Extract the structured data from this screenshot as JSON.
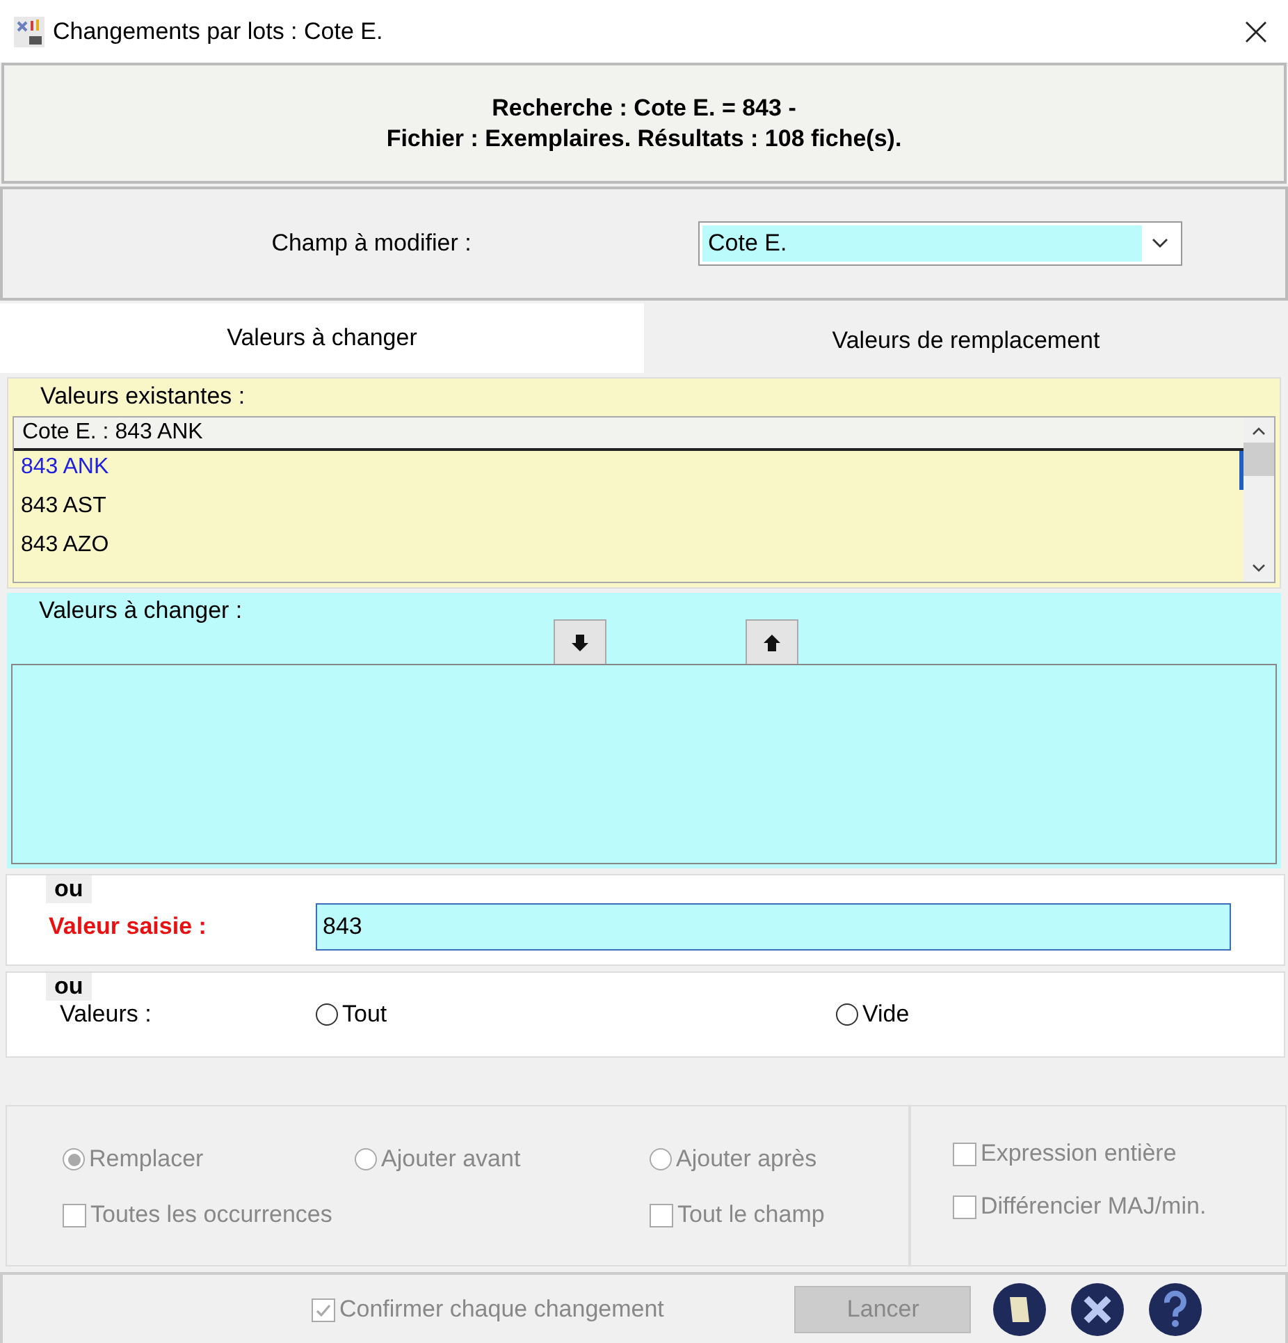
{
  "window": {
    "title": "Changements par lots : Cote E."
  },
  "header": {
    "line_1": "Recherche : Cote E. = 843 -",
    "line_2": "Fichier : Exemplaires. Résultats : 108 fiche(s)."
  },
  "field_select": {
    "label": "Champ à modifier :",
    "value": "Cote E."
  },
  "tabs": [
    {
      "label": "Valeurs à changer",
      "selected": true
    },
    {
      "label": "Valeurs de remplacement",
      "selected": false
    }
  ],
  "existing": {
    "title": "Valeurs existantes :",
    "column": "Cote E.  : 843 ANK",
    "rows": [
      {
        "text": "843 ANK",
        "selected": true
      },
      {
        "text": "843 AST",
        "selected": false
      },
      {
        "text": "843 AZO",
        "selected": false
      }
    ]
  },
  "to_change": {
    "title": "Valeurs à changer :"
  },
  "entered": {
    "or": "ou",
    "label": "Valeur saisie :",
    "value": "843"
  },
  "values": {
    "or": "ou",
    "label": "Valeurs :",
    "options": [
      {
        "label": "Tout",
        "selected": false
      },
      {
        "label": "Vide",
        "selected": false
      }
    ]
  },
  "mode": {
    "options": [
      {
        "label": "Remplacer",
        "selected": true,
        "disabled": true
      },
      {
        "label": "Ajouter avant",
        "selected": false,
        "disabled": true
      },
      {
        "label": "Ajouter après",
        "selected": false,
        "disabled": true
      }
    ],
    "checks": [
      {
        "label": "Toutes les occurrences",
        "checked": false,
        "disabled": true
      },
      {
        "label": "Tout le champ",
        "checked": false,
        "disabled": true
      }
    ],
    "side_checks": [
      {
        "label": "Expression entière",
        "checked": false,
        "disabled": true
      },
      {
        "label": "Différencier MAJ/min.",
        "checked": false,
        "disabled": true
      }
    ]
  },
  "footer": {
    "confirm": {
      "label": "Confirmer chaque changement",
      "checked": true,
      "disabled": true
    },
    "run": {
      "label": "Lancer",
      "disabled": true
    }
  }
}
